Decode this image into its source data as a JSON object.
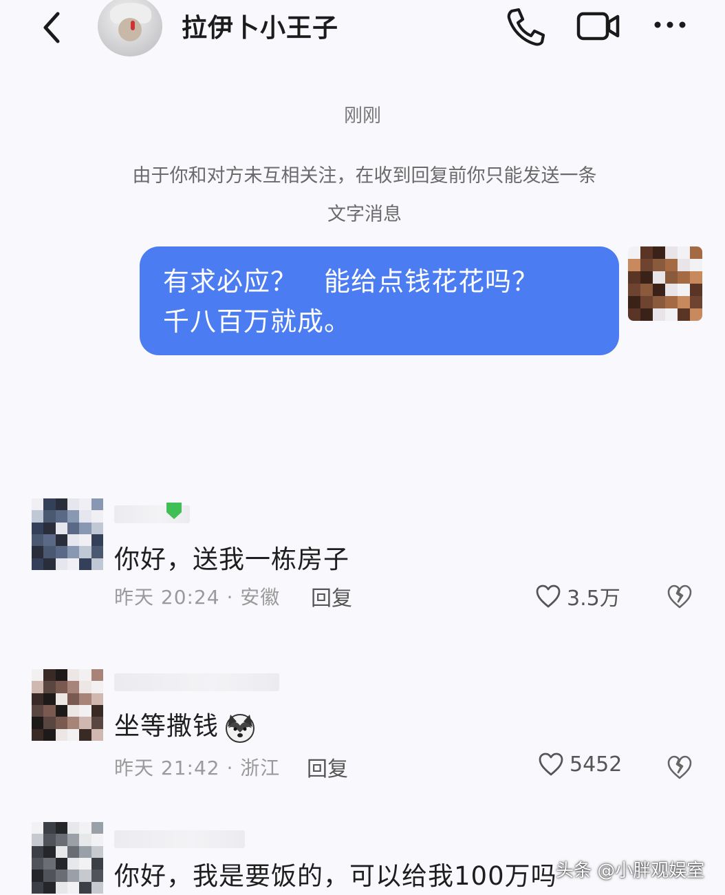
{
  "header": {
    "title": "拉伊卜小王子",
    "back_icon": "chevron-left-icon",
    "call_icon": "phone-icon",
    "video_icon": "video-camera-icon",
    "more_icon": "more-dots-icon"
  },
  "chat": {
    "time_label": "刚刚",
    "notice_line1": "由于你和对方未互相关注，在收到回复前你只能发送一条",
    "notice_line2": "文字消息",
    "sent_message": {
      "line1": "有求必应？　能给点钱花花吗？",
      "line2": "千八百万就成。",
      "bubble_color": "#4b7cf1"
    }
  },
  "comments": [
    {
      "text": "你好，送我一栋房子",
      "meta": "昨天 20:24 · 安徽",
      "reply_label": "回复",
      "likes": "3.5万"
    },
    {
      "text": "坐等撒钱",
      "meta": "昨天 21:42 · 浙江",
      "reply_label": "回复",
      "likes": "5452"
    },
    {
      "text": "你好，我是要饭的，可以给我100万吗"
    }
  ],
  "watermark": "头条 @小胖观娱室"
}
